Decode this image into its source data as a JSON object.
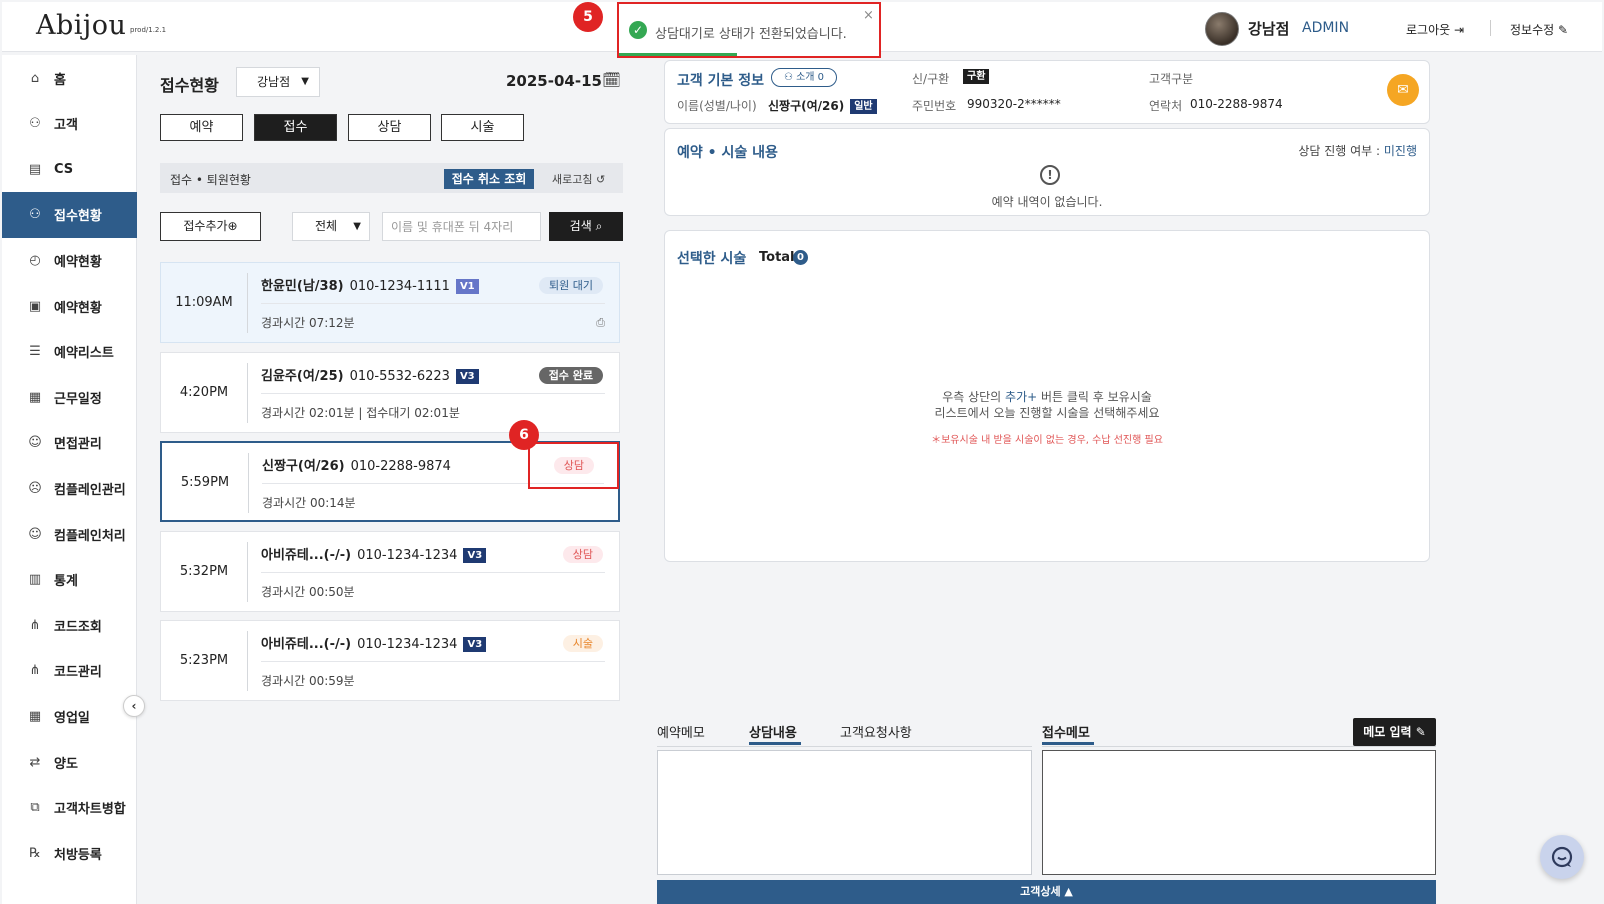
{
  "header": {
    "logo": "Abijou",
    "version": "prod/1.2.1",
    "branch": "강남점",
    "role": "ADMIN",
    "logout": "로그아웃",
    "edit_info": "정보수정"
  },
  "toast": {
    "message": "상담대기로 상태가 전환되었습니다.",
    "close": "×",
    "marker": "5"
  },
  "card_marker": "6",
  "sidebar": {
    "items": [
      {
        "label": "홈",
        "icon": "home-icon"
      },
      {
        "label": "고객",
        "icon": "users-icon"
      },
      {
        "label": "CS",
        "icon": "document-icon"
      },
      {
        "label": "접수현황",
        "icon": "reception-icon"
      },
      {
        "label": "예약현황",
        "icon": "calendar-clock-icon"
      },
      {
        "label": "예약현황",
        "icon": "building-icon"
      },
      {
        "label": "예약리스트",
        "icon": "list-icon"
      },
      {
        "label": "근무일정",
        "icon": "schedule-icon"
      },
      {
        "label": "면접관리",
        "icon": "interview-icon"
      },
      {
        "label": "컴플레인관리",
        "icon": "complaint-icon"
      },
      {
        "label": "컴플레인처리",
        "icon": "smile-icon"
      },
      {
        "label": "통계",
        "icon": "chart-icon"
      },
      {
        "label": "코드조회",
        "icon": "tree-icon"
      },
      {
        "label": "코드관리",
        "icon": "tree-icon"
      },
      {
        "label": "영업일",
        "icon": "calendar-icon"
      },
      {
        "label": "양도",
        "icon": "transfer-icon"
      },
      {
        "label": "고객차트병합",
        "icon": "merge-icon"
      },
      {
        "label": "처방등록",
        "icon": "prescription-icon"
      }
    ],
    "active_index": 3,
    "collapse": "‹"
  },
  "reception": {
    "title": "접수현황",
    "branch_select": "강남점",
    "date": "2025-04-15",
    "tabs": [
      "예약",
      "접수",
      "상담",
      "시술"
    ],
    "active_tab": 1,
    "section_label": "접수 • 퇴원현황",
    "cancel_lookup": "접수 취소 조회",
    "refresh": "새로고침",
    "add_button": "접수추가",
    "filter": "전체",
    "search_placeholder": "이름 및 휴대폰 뒤 4자리",
    "search_button": "검색",
    "cards": [
      {
        "time": "11:09AM",
        "name": "한윤민(남/38)",
        "phone": "010-1234-1111",
        "vip": "V1",
        "status": "퇴원 대기",
        "elapsed": "경과시간 07:12분"
      },
      {
        "time": "4:20PM",
        "name": "김윤주(여/25)",
        "phone": "010-5532-6223",
        "vip": "V3",
        "status": "접수 완료",
        "elapsed": "경과시간 02:01분 | 접수대기 02:01분"
      },
      {
        "time": "5:59PM",
        "name": "신짱구(여/26)",
        "phone": "010-2288-9874",
        "vip": "",
        "status": "상담",
        "elapsed": "경과시간 00:14분"
      },
      {
        "time": "5:32PM",
        "name": "아비쥬테...(-/-)",
        "phone": "010-1234-1234",
        "vip": "V3",
        "status": "상담",
        "elapsed": "경과시간 00:50분"
      },
      {
        "time": "5:23PM",
        "name": "아비쥬테...(-/-)",
        "phone": "010-1234-1234",
        "vip": "V3",
        "status": "시술",
        "elapsed": "경과시간 00:59분"
      }
    ]
  },
  "customer": {
    "title": "고객 기본 정보",
    "intro": "소개 0",
    "name_label": "이름(성별/나이)",
    "name_value": "신짱구(여/26)",
    "grade_badge": "일반",
    "newold_label": "신/구환",
    "newold_badge": "구환",
    "rrn_label": "주민번호",
    "rrn_value": "990320-2******",
    "type_label": "고객구분",
    "contact_label": "연락처",
    "contact_value": "010-2288-9874"
  },
  "reservation": {
    "title": "예약 • 시술 내용",
    "progress_label": "상담 진행 여부 :",
    "progress_value": "미진행",
    "empty": "예약 내역이 없습니다."
  },
  "treatment": {
    "title": "선택한 시술",
    "total_label": "Total",
    "total_count": "0",
    "guide_1a": "우측 상단의 ",
    "guide_1b": "추가+",
    "guide_1c": " 버튼 클릭 후 보유시술",
    "guide_2": "리스트에서 오늘 진행할 시술을 선택해주세요",
    "warn": "＊보유시술 내 받을 시술이 없는 경우, 수납 선진행 필요"
  },
  "memo": {
    "tabs": [
      "예약메모",
      "상담내용",
      "고객요청사항"
    ],
    "active_tab": 1,
    "right_tab": "접수메모",
    "input_button": "메모 입력",
    "detail_bar": "고객상세 ▲"
  }
}
